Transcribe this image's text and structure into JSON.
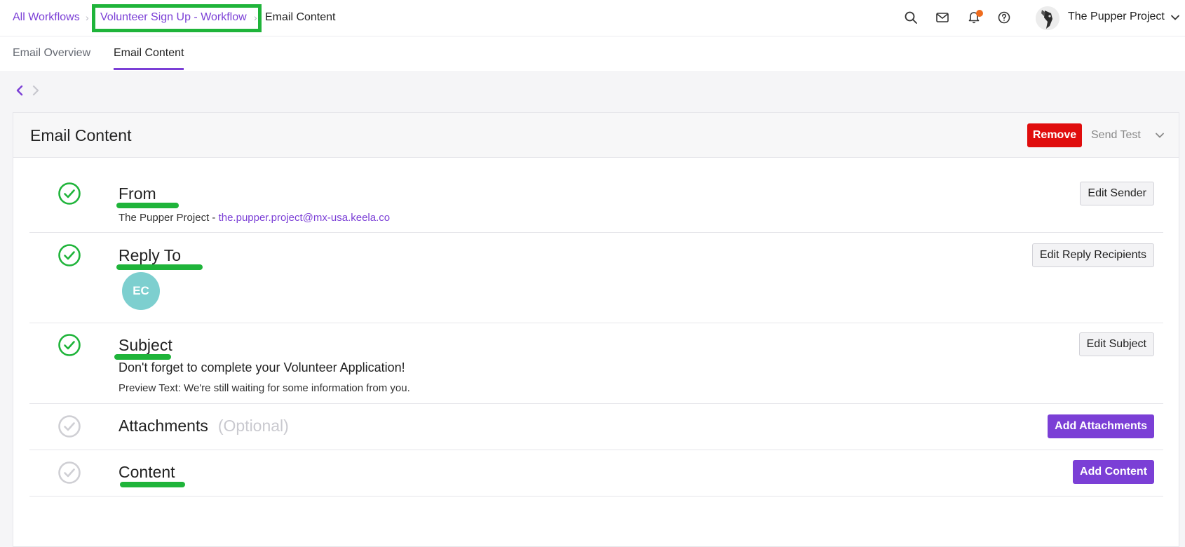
{
  "breadcrumb": {
    "all_workflows": "All Workflows",
    "workflow": "Volunteer Sign Up - Workflow",
    "current": "Email Content",
    "separator": "›"
  },
  "header": {
    "org_name": "The Pupper Project",
    "icons": [
      "search-icon",
      "mail-icon",
      "bell-icon",
      "help-icon",
      "chevron-down-icon"
    ]
  },
  "tabs": [
    {
      "label": "Email Overview",
      "active": false
    },
    {
      "label": "Email Content",
      "active": true
    }
  ],
  "card": {
    "title": "Email Content",
    "remove_label": "Remove",
    "send_test_label": "Send Test"
  },
  "sections": {
    "from": {
      "title": "From",
      "sender_name": "The Pupper Project - ",
      "sender_email": "the.pupper.project@mx-usa.keela.co",
      "button": "Edit Sender",
      "complete": true
    },
    "reply_to": {
      "title": "Reply To",
      "avatar_initials": "EC",
      "button": "Edit Reply Recipients",
      "complete": true
    },
    "subject": {
      "title": "Subject",
      "subject_line": "Don't forget to complete your Volunteer Application!",
      "preview_text": "Preview Text: We're still waiting for some information from you.",
      "button": "Edit Subject",
      "complete": true
    },
    "attachments": {
      "title": "Attachments",
      "optional_label": "(Optional)",
      "button": "Add Attachments",
      "complete": false
    },
    "content": {
      "title": "Content",
      "button": "Add Content",
      "complete": false
    }
  },
  "colors": {
    "accent": "#7b3fd6",
    "remove": "#e00d0d",
    "complete": "#1fb43a",
    "incomplete": "#cfcfd4",
    "highlight": "#1fb43a",
    "notification": "#ef6c1e",
    "avatar": "#7dcfcf"
  }
}
